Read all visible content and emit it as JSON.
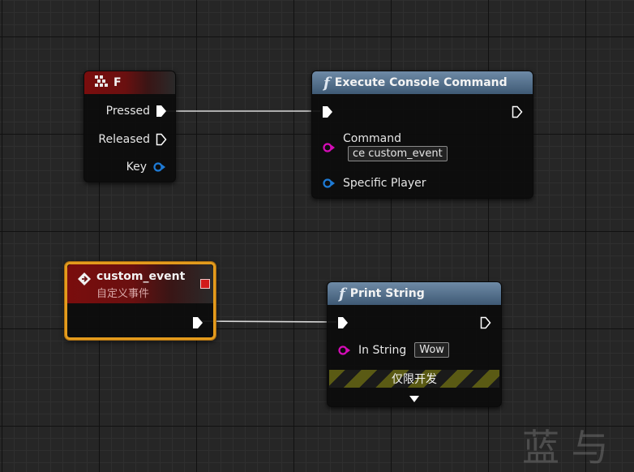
{
  "key_node": {
    "title": "F",
    "pins": {
      "pressed": "Pressed",
      "released": "Released",
      "key": "Key"
    }
  },
  "console_node": {
    "title": "Execute Console Command",
    "command_label": "Command",
    "command_value": "ce custom_event",
    "player_label": "Specific Player"
  },
  "event_node": {
    "title": "custom_event",
    "subtitle": "自定义事件"
  },
  "print_node": {
    "title": "Print String",
    "in_string_label": "In String",
    "in_string_value": "Wow",
    "dev_only": "仅限开发"
  },
  "watermark": "蓝 与",
  "colors": {
    "exec_pin": "#ffffff",
    "string_pin": "#d60cb8",
    "object_pin": "#1e7bd6",
    "selection": "#e49b1c"
  },
  "icons": [
    "keyboard-icon",
    "function-icon",
    "event-icon",
    "exec-pin-icon",
    "string-pin-icon",
    "object-pin-icon",
    "expand-arrow-icon"
  ]
}
